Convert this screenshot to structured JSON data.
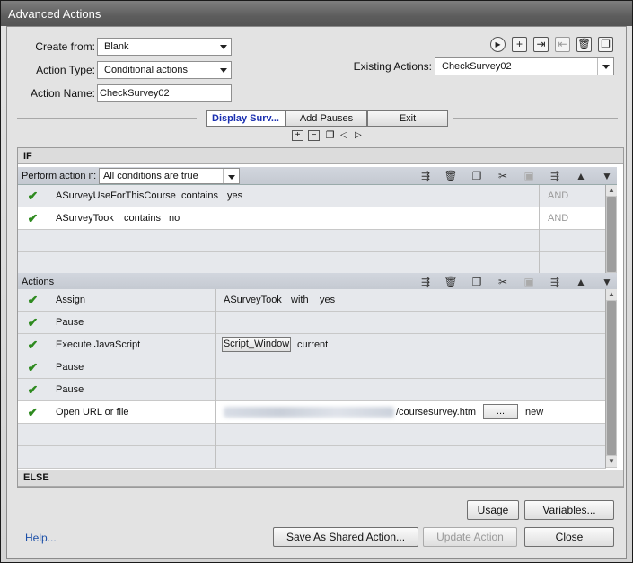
{
  "window": {
    "title": "Advanced Actions"
  },
  "form": {
    "create_from_label": "Create from:",
    "create_from_value": "Blank",
    "action_type_label": "Action Type:",
    "action_type_value": "Conditional actions",
    "action_name_label": "Action Name:",
    "action_name_value": "CheckSurvey02",
    "existing_actions_label": "Existing Actions:",
    "existing_actions_value": "CheckSurvey02"
  },
  "tabs": [
    {
      "label": "Display Surv...",
      "active": true
    },
    {
      "label": "Add Pauses",
      "active": false
    },
    {
      "label": "Exit",
      "active": false
    }
  ],
  "if_section": {
    "title": "IF",
    "perform_label": "Perform action if:",
    "perform_value": "All conditions are true",
    "conditions": [
      {
        "variable": "ASurveyUseForThisCourse",
        "op": "contains",
        "value": "yes",
        "logic": "AND"
      },
      {
        "variable": "ASurveyTook",
        "op": "contains",
        "value": "no",
        "logic": "AND"
      }
    ]
  },
  "actions_section": {
    "title": "Actions",
    "rows": [
      {
        "action": "Assign",
        "target": "ASurveyTook",
        "extra1": "with",
        "extra2": "yes"
      },
      {
        "action": "Pause",
        "target": "",
        "extra1": "",
        "extra2": ""
      },
      {
        "action": "Execute JavaScript",
        "button": "Script_Window",
        "extra1": "current"
      },
      {
        "action": "Pause",
        "target": ""
      },
      {
        "action": "Pause",
        "target": ""
      },
      {
        "action": "Open URL or file",
        "url_visible": "/coursesurvey.htm",
        "button": "...",
        "extra1": "new"
      }
    ]
  },
  "else_section": {
    "title": "ELSE"
  },
  "footer": {
    "help": "Help...",
    "usage": "Usage",
    "variables": "Variables...",
    "save_shared": "Save As Shared Action...",
    "update": "Update Action",
    "close": "Close"
  },
  "colors": {
    "check": "#2e8a1f",
    "link": "#1b4fa8",
    "active_tab_text": "#1a2fb0"
  }
}
